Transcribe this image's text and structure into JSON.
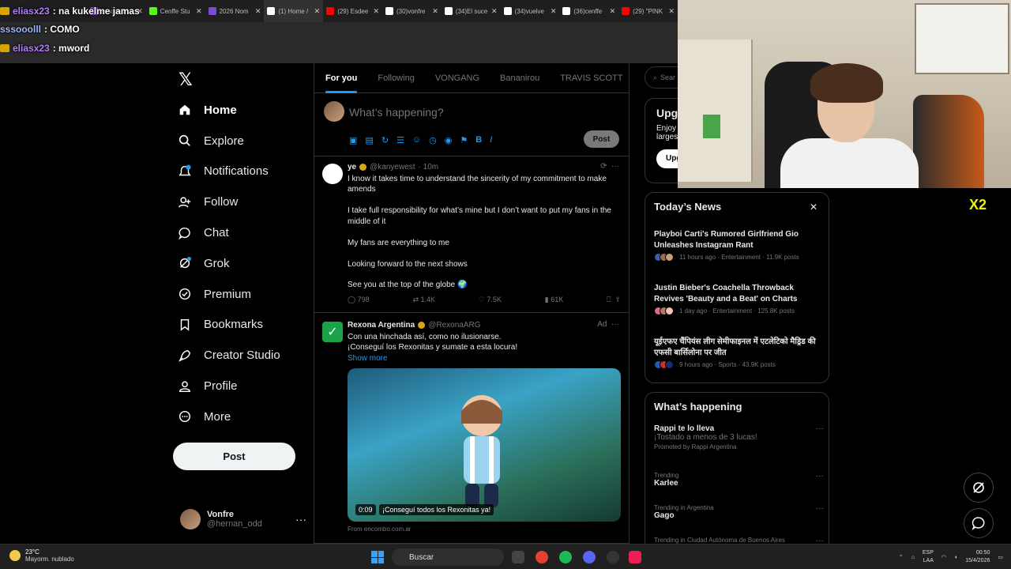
{
  "browser_tabs": [
    {
      "title": "sssooolll - KE",
      "color": "#9146ff"
    },
    {
      "title": "Cenffe Stu",
      "color": "#53fc18"
    },
    {
      "title": "2026 Nom",
      "color": "#7a4bd6"
    },
    {
      "title": "(1) Home /",
      "color": "#ffffff"
    },
    {
      "title": "(29) Esdee",
      "color": "#ff0000"
    },
    {
      "title": "(30)vonfre",
      "color": "#ffffff"
    },
    {
      "title": "(34)El suce",
      "color": "#ffffff"
    },
    {
      "title": "(34)vuelve",
      "color": "#ffffff"
    },
    {
      "title": "(36)cenffe",
      "color": "#ffffff"
    },
    {
      "title": "(29) \"PINK",
      "color": "#ff0000"
    }
  ],
  "chat": [
    {
      "user": "eliasx23",
      "text": ": na kukelme jamas",
      "style": "u1",
      "badge": true
    },
    {
      "user": "sssooolll",
      "text": ": COMO",
      "style": "u2",
      "badge": false
    },
    {
      "user": "eliasx23",
      "text": ": mword",
      "style": "u1",
      "badge": true
    }
  ],
  "nav": {
    "logo": "𝕏",
    "items": [
      {
        "label": "Home",
        "icon": "home-icon",
        "active": true
      },
      {
        "label": "Explore",
        "icon": "search-icon"
      },
      {
        "label": "Notifications",
        "icon": "bell-icon"
      },
      {
        "label": "Follow",
        "icon": "person-add-icon"
      },
      {
        "label": "Chat",
        "icon": "chat-icon"
      },
      {
        "label": "Grok",
        "icon": "grok-icon"
      },
      {
        "label": "Premium",
        "icon": "premium-icon"
      },
      {
        "label": "Bookmarks",
        "icon": "bookmark-icon"
      },
      {
        "label": "Creator Studio",
        "icon": "rocket-icon"
      },
      {
        "label": "Profile",
        "icon": "person-icon"
      },
      {
        "label": "More",
        "icon": "more-circle-icon"
      }
    ],
    "post_label": "Post",
    "notification_count": "1",
    "account": {
      "name": "Vonfre",
      "handle": "@hernan_odd",
      "more": "···"
    }
  },
  "feed": {
    "tabs": [
      "For you",
      "Following",
      "VONGANG",
      "Bananirou",
      "TRAVIS SCOTT"
    ],
    "compose_placeholder": "What’s happening?",
    "compose_post": "Post",
    "tweets": [
      {
        "name": "ye",
        "handle": "@kanyewest",
        "time": "· 10m",
        "paragraphs": [
          "I know it takes time to understand the sincerity of my commitment to make amends",
          "I take full responsibility for what’s mine but I don’t want to put my fans in the middle of it",
          "My fans are everything to me",
          "Looking forward to the next shows",
          "See you at the top of the globe 🌍"
        ],
        "replies": "798",
        "reposts": "1.4K",
        "likes": "7.5K",
        "views": "61K"
      },
      {
        "name": "Rexona Argentina",
        "handle": "@RexonaARG",
        "ad": "Ad",
        "lines": [
          "Con una hinchada así, como no ilusionarse.",
          "¡Conseguí los Rexonitas y sumate a esta locura!"
        ],
        "show_more": "Show more",
        "video_time": "0:09",
        "video_caption": "¡Conseguí todos los Rexonitas ya!",
        "source": "From encombo.com.ar"
      }
    ]
  },
  "right": {
    "search_placeholder": "Sear",
    "upgrade": {
      "title": "Upg",
      "body1": "Enjoy",
      "body2": "larges",
      "button": "Upg"
    },
    "news_title": "Today’s News",
    "news": [
      {
        "title": "Playboi Carti's Rumored Girlfriend Gio Unleashes Instagram Rant",
        "meta": "11 hours ago · Entertainment · 11.9K posts"
      },
      {
        "title": "Justin Bieber's Coachella Throwback Revives 'Beauty and a Beat' on Charts",
        "meta": "1 day ago · Entertainment · 125.8K posts"
      },
      {
        "title": "यूईएफए चैंपियंस लीग सेमीफाइनल में एटलेटिको मैड्रिड की एफसी बार्सिलोना पर जीत",
        "meta": "9 hours ago · Sports · 43.9K posts"
      }
    ],
    "happening_title": "What’s happening",
    "happening": [
      {
        "context": "",
        "title": "Rappi te lo lleva",
        "sub": "¡Tostado a menos de 3 lucas!",
        "promo": "Promoted by Rappi Argentina"
      },
      {
        "context": "Trending",
        "title": "Karlee"
      },
      {
        "context": "Trending in Argentina",
        "title": "Gago"
      },
      {
        "context": "Trending in Ciudad Autónoma de Buenos Aires",
        "title": ""
      }
    ]
  },
  "overlay_badge": "X2",
  "taskbar": {
    "temp": "23°C",
    "weather": "Mayorm. nublado",
    "search": "Buscar",
    "lang": "ESP",
    "lang2": "LAA",
    "time": "00:50",
    "date": "15/4/2026"
  },
  "colors": {
    "accent": "#1d9bf0",
    "background": "#000000",
    "border": "#2f3336",
    "muted": "#71767b"
  }
}
